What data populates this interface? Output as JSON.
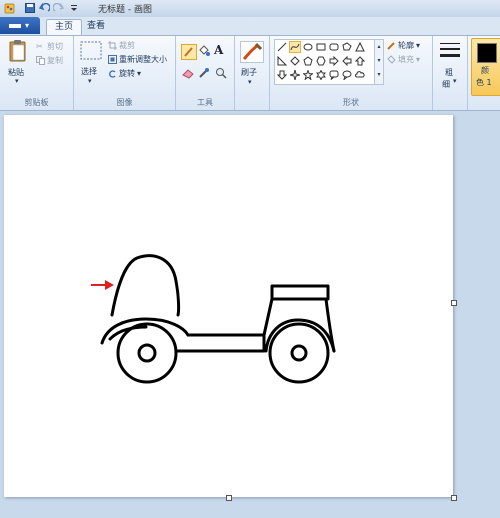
{
  "titlebar": {
    "title": "无标题 - 画图"
  },
  "tabs": {
    "home": "主页",
    "view": "查看"
  },
  "clipboard": {
    "paste": "粘贴",
    "cut": "剪切",
    "copy": "复制",
    "group": "剪贴板"
  },
  "image": {
    "select": "选择",
    "crop": "裁剪",
    "resize": "重新调整大小",
    "rotate": "旋转",
    "group": "图像"
  },
  "tools": {
    "group": "工具",
    "text_tool": "A"
  },
  "brushes": {
    "label": "刷子"
  },
  "shapes": {
    "outline": "轮廓",
    "fill": "填充",
    "group": "形状"
  },
  "size": {
    "label1": "粗",
    "label2": "细"
  },
  "colors": {
    "color1_label1": "颜",
    "color1_label2": "色 1",
    "color1": "#000000"
  },
  "accent": {
    "file_blue": "#2a5ea9",
    "arrow_red": "#e02020"
  }
}
